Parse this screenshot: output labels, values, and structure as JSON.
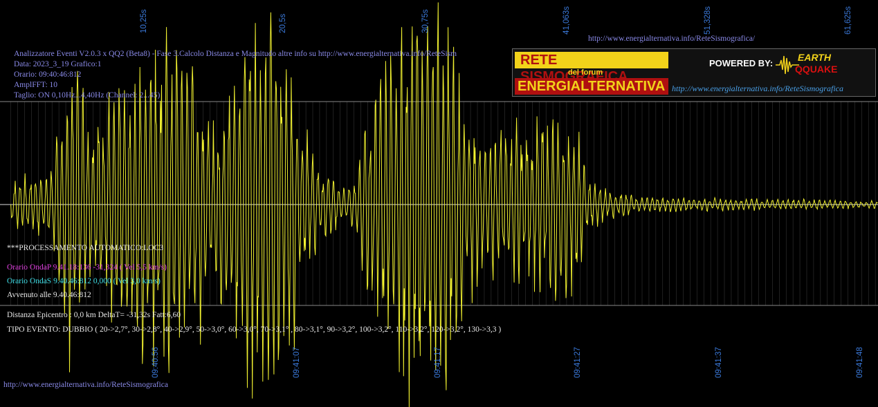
{
  "header": {
    "url_top": "http://www.energialternativa.info/ReteSismografica/",
    "title_line": "Analizzatore Eventi V2.0.3 x QQ2 (Beta8) - Fase 3.Calcolo Distanza e Magnitudo altre info su http://www.energialternativa.info/ReteSism",
    "data_line": "Data: 2023_3_19 Grafico:1",
    "orario_line": "Orario: 09:40:46:812",
    "ampl_line": "AmplFFT: 10",
    "taglio_line": "Taglio: ON 0,10Hz...4,40Hz       (Channel: 2...45)"
  },
  "banner": {
    "rete": "RETE SISMOGRAFICA",
    "del_forum": "del forum",
    "energia": "ENERGIALTERNATIVA",
    "powered": "POWERED BY:",
    "earth": "EARTH",
    "quake": "QQUAKE",
    "url": "http://www.energialternativa.info/ReteSismografica"
  },
  "processing": {
    "auto": "***PROCESSAMENTO AUTOMATICO:LOC3",
    "onda_p": "Orario OndaP 9.41.18:136 -31,324 ( Vel 5,5 km/s)",
    "onda_s": "Orario OndaS 9.40.46:812  0,000 ( Vel 3,0 km/s)",
    "avvenuto": "Avvenuto alle 9.40.46:812",
    "distanza": "Distanza Epicentro : 0,0 km DeltaT= -31,32s  Fatt:6,60",
    "tipo": "TIPO EVENTO: DUBBIO ( 20->2,7°, 30->2,8°, 40->2,9°, 50->3,0°, 60->3,0°, 70->3,1° , 80->3,1°, 90->3,2°, 100->3,2°, 110->3,2°, 120->3,2°, 130->3,3 )"
  },
  "footer": {
    "url": "http://www.energialternativa.info/ReteSismografica"
  },
  "colors": {
    "signal": "#f0f030",
    "background": "#000000",
    "axis_label": "#3a78d8",
    "grid": "#6a6a6a"
  },
  "chart_data": {
    "type": "line",
    "title": "",
    "xlabel": "",
    "ylabel": "",
    "seconds_ticks": [
      "10,25s",
      "20,5s",
      "30,75s",
      "41,063s",
      "51,328s",
      "61,625s"
    ],
    "time_ticks": [
      "09:40:56",
      "09:41:07",
      "09:41:17",
      "09:41:27",
      "09:41:37",
      "09:41:48"
    ],
    "x_range": [
      "09:40:46",
      "09:41:48"
    ],
    "grid": true,
    "series": [
      {
        "name": "",
        "color": "#f0f030",
        "envelope": [
          [
            0,
            40
          ],
          [
            3,
            60
          ],
          [
            4.5,
            280
          ],
          [
            6,
            150
          ],
          [
            8,
            200
          ],
          [
            9,
            250
          ],
          [
            10,
            300
          ],
          [
            11.5,
            280
          ],
          [
            13,
            250
          ],
          [
            15,
            150
          ],
          [
            17,
            320
          ],
          [
            19,
            320
          ],
          [
            20.5,
            250
          ],
          [
            21.5,
            120
          ],
          [
            22.5,
            60
          ],
          [
            24,
            40
          ],
          [
            25,
            35
          ],
          [
            26,
            150
          ],
          [
            27.5,
            250
          ],
          [
            29,
            320
          ],
          [
            30.5,
            320
          ],
          [
            32,
            300
          ],
          [
            33.5,
            150
          ],
          [
            34.5,
            110
          ],
          [
            36,
            130
          ],
          [
            38,
            140
          ],
          [
            40,
            150
          ],
          [
            41,
            160
          ],
          [
            41.4,
            110
          ],
          [
            42,
            45
          ],
          [
            43,
            30
          ],
          [
            46,
            12
          ],
          [
            52,
            10
          ],
          [
            58,
            8
          ],
          [
            62,
            6
          ]
        ]
      }
    ]
  }
}
